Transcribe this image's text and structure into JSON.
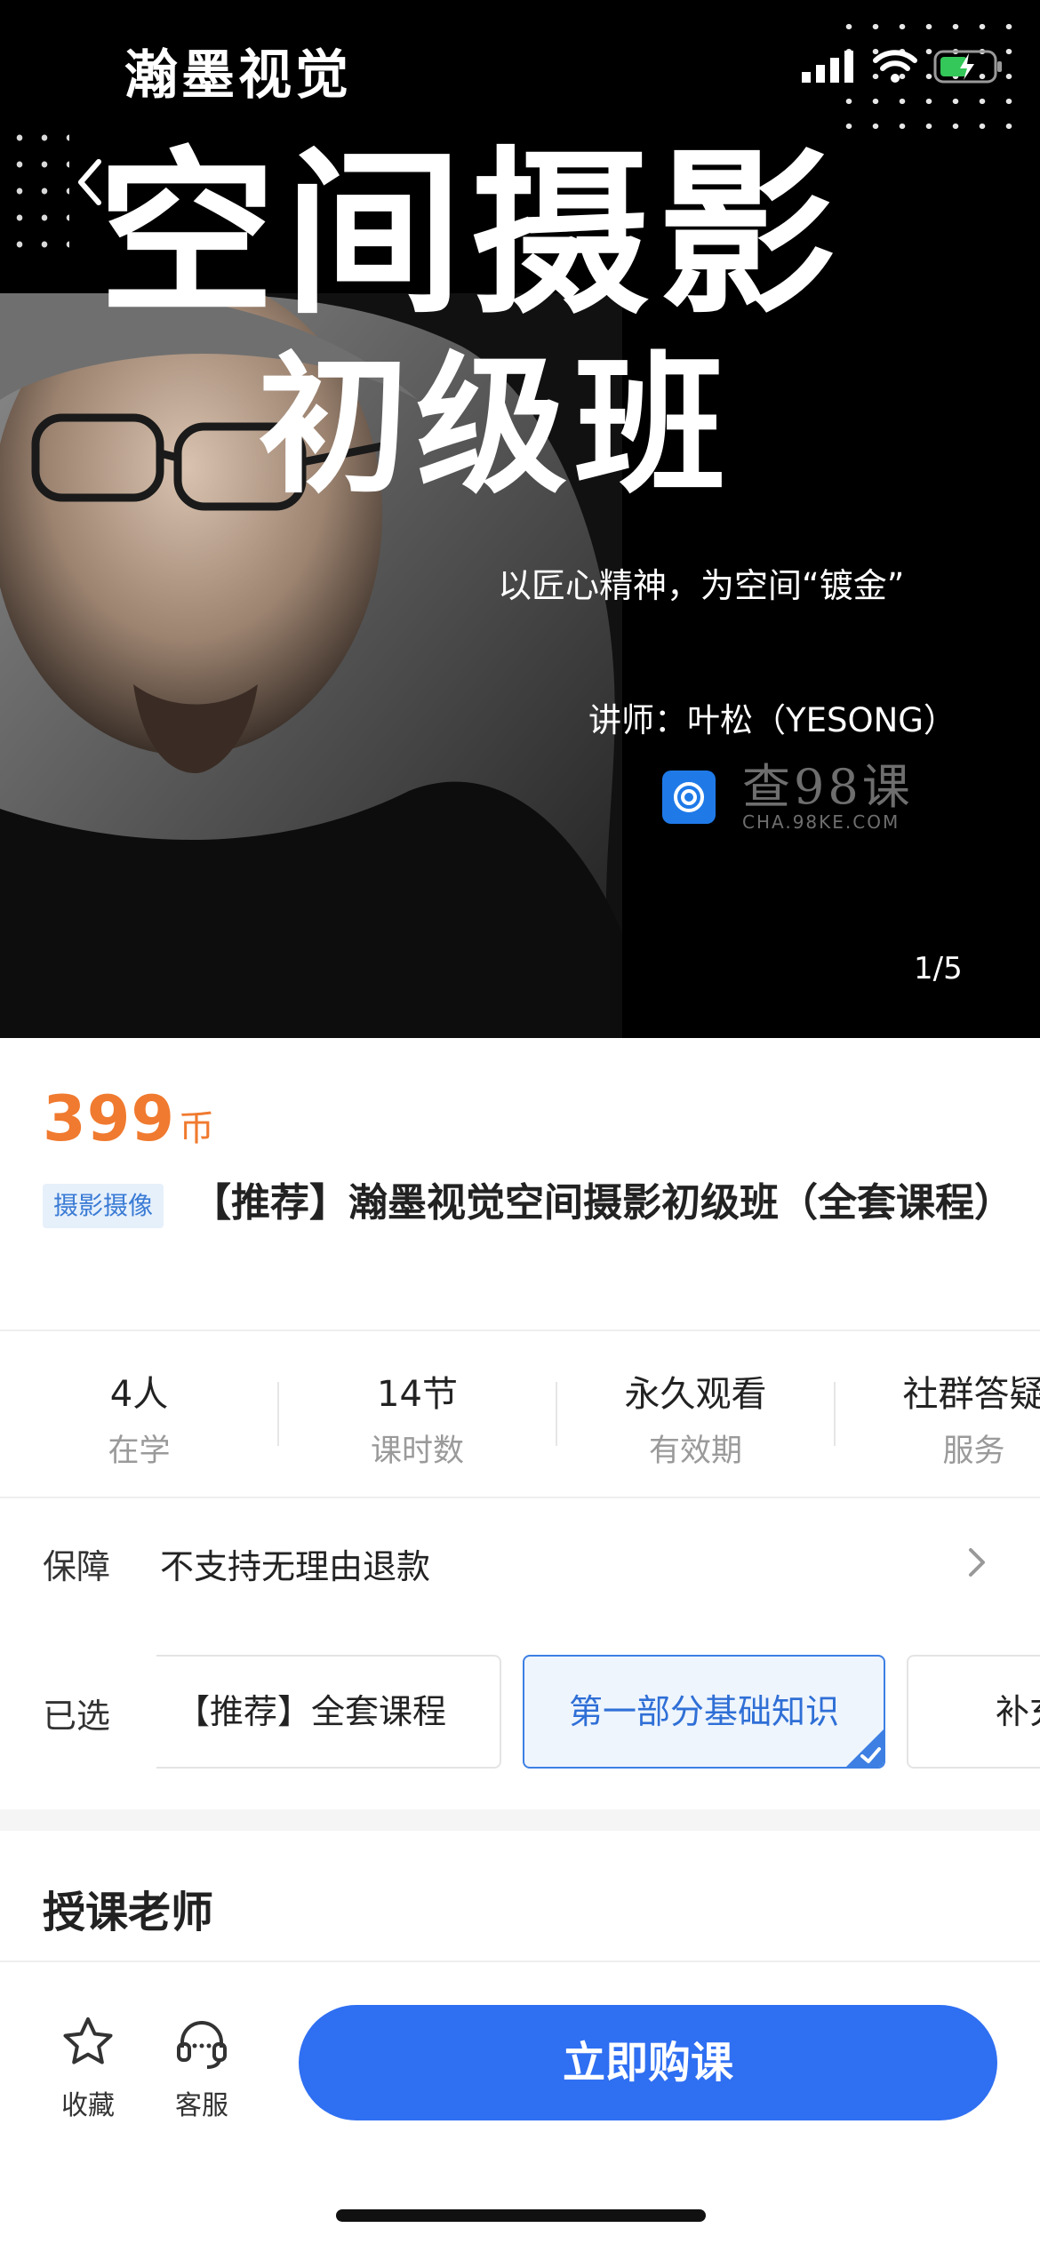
{
  "hero": {
    "brand": "瀚墨视觉",
    "title_line1": "空间摄影",
    "title_line2": "初级班",
    "slogan": "以匠心精神，为空间“镀金”",
    "lecturer": "讲师：叶松（YESONG）",
    "watermark_main": "查98课",
    "watermark_sub": "CHA.98KE.COM",
    "page_indicator": "1/5"
  },
  "status_bar": {
    "icons": [
      "signal-icon",
      "wifi-icon",
      "battery-charging-icon"
    ]
  },
  "price": {
    "amount": "399",
    "unit": "币",
    "color": "#f07a2f"
  },
  "course": {
    "tag": "摄影摄像",
    "title": "【推荐】瀚墨视觉空间摄影初级班（全套课程）"
  },
  "stats": [
    {
      "value": "4人",
      "label": "在学"
    },
    {
      "value": "14节",
      "label": "课时数"
    },
    {
      "value": "永久观看",
      "label": "有效期"
    },
    {
      "value": "社群答疑",
      "label": "服务"
    }
  ],
  "guarantee": {
    "label": "保障",
    "value": "不支持无理由退款"
  },
  "selected": {
    "label": "已选",
    "options": [
      "【推荐】全套课程",
      "第一部分基础知识",
      "补充"
    ],
    "active_index": 1
  },
  "teacher": {
    "heading": "授课老师"
  },
  "bottom_bar": {
    "favorite_label": "收藏",
    "service_label": "客服",
    "buy_label": "立即购课",
    "accent": "#2f6ff2"
  }
}
